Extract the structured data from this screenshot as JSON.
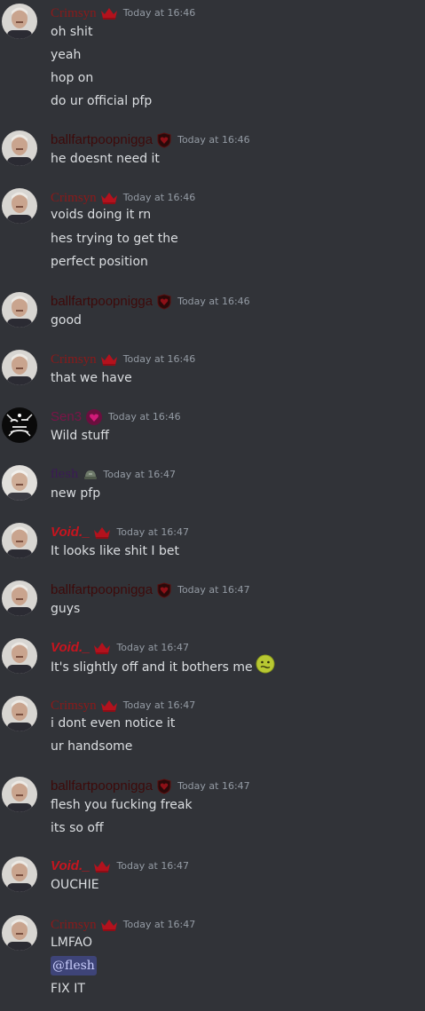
{
  "colors": {
    "background": "#313338",
    "text": "#dbdee1",
    "timestamp": "#949ba4",
    "crimsyn": "#8b1a1a",
    "ballfart": "#3d0a0a",
    "void": "#c7141e",
    "sen": "#7a1447",
    "flesh": "#3a1a55"
  },
  "messages": [
    {
      "author": "Crimsyn",
      "badge": "crown-icon",
      "time": "Today at 16:46",
      "lines": [
        "oh shit",
        "yeah",
        "hop on",
        "do ur official pfp"
      ]
    },
    {
      "author": "ballfartpoopnigga",
      "badge": "shield-heart-icon",
      "time": "Today at 16:46",
      "lines": [
        "he doesnt need it"
      ]
    },
    {
      "author": "Crimsyn",
      "badge": "crown-icon",
      "time": "Today at 16:46",
      "lines": [
        "voids doing it rn",
        "hes trying to get the",
        "perfect position"
      ]
    },
    {
      "author": "ballfartpoopnigga",
      "badge": "shield-heart-icon",
      "time": "Today at 16:46",
      "lines": [
        "good"
      ]
    },
    {
      "author": "Crimsyn",
      "badge": "crown-icon",
      "time": "Today at 16:46",
      "lines": [
        "that we have"
      ]
    },
    {
      "author": "Sen3",
      "badge": "heart-badge-icon",
      "time": "Today at 16:46",
      "lines": [
        "Wild stuff"
      ]
    },
    {
      "author": "flesh",
      "badge": "helmet-icon",
      "time": "Today at 16:47",
      "lines": [
        "new pfp"
      ]
    },
    {
      "author": "Void._",
      "badge": "crown-icon",
      "time": "Today at 16:47",
      "lines": [
        "It looks like shit I bet"
      ]
    },
    {
      "author": "ballfartpoopnigga",
      "badge": "shield-heart-icon",
      "time": "Today at 16:47",
      "lines": [
        "guys"
      ]
    },
    {
      "author": "Void._",
      "badge": "crown-icon",
      "time": "Today at 16:47",
      "lines": [
        "It's slightly off and it bothers me"
      ],
      "emoji": "nauseated-face-icon"
    },
    {
      "author": "Crimsyn",
      "badge": "crown-icon",
      "time": "Today at 16:47",
      "lines": [
        "i dont even notice it",
        "ur handsome"
      ]
    },
    {
      "author": "ballfartpoopnigga",
      "badge": "shield-heart-icon",
      "time": "Today at 16:47",
      "lines": [
        "flesh you fucking freak",
        "its so off"
      ]
    },
    {
      "author": "Void._",
      "badge": "crown-icon",
      "time": "Today at 16:47",
      "lines": [
        "OUCHIE"
      ]
    },
    {
      "author": "Crimsyn",
      "badge": "crown-icon",
      "time": "Today at 16:47",
      "lines": [
        "LMFAO",
        "FIX IT"
      ],
      "mention": "@flesh"
    }
  ]
}
